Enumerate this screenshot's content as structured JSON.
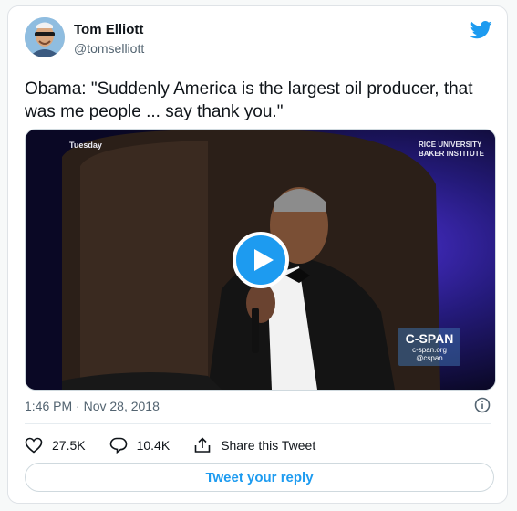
{
  "author": {
    "name": "Tom Elliott",
    "handle": "@tomselliott"
  },
  "tweet": {
    "text": "Obama: \"Suddenly America is the largest oil producer, that was me people ... say thank you.\""
  },
  "media": {
    "overlay_day": "Tuesday",
    "overlay_org_line1": "RICE UNIVERSITY",
    "overlay_org_line2": "BAKER INSTITUTE",
    "network_logo": "C-SPAN",
    "network_url": "c-span.org",
    "network_handle": "@cspan"
  },
  "meta": {
    "timestamp": "1:46 PM · Nov 28, 2018"
  },
  "actions": {
    "likes": "27.5K",
    "replies": "10.4K",
    "share_label": "Share this Tweet"
  },
  "reply_button": {
    "label": "Tweet your reply"
  },
  "colors": {
    "accent": "#1d9bf0",
    "text_secondary": "#536471"
  },
  "icons": [
    "twitter-bird-icon",
    "play-icon",
    "info-icon",
    "heart-icon",
    "reply-icon",
    "share-icon"
  ]
}
